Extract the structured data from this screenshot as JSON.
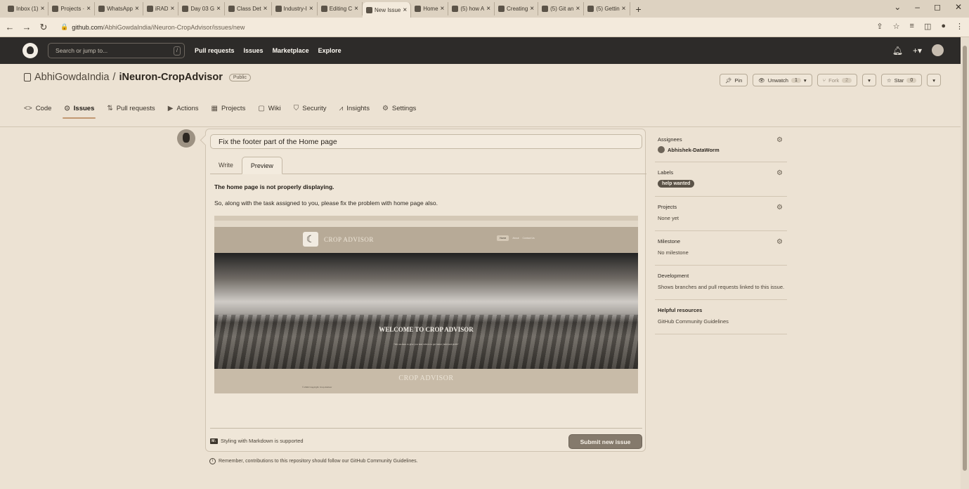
{
  "browser": {
    "tabs": [
      {
        "label": "Inbox (1)",
        "active": false
      },
      {
        "label": "Projects ·",
        "active": false
      },
      {
        "label": "WhatsApp",
        "active": false
      },
      {
        "label": "iRAD",
        "active": false
      },
      {
        "label": "Day 03 G",
        "active": false
      },
      {
        "label": "Class Det",
        "active": false
      },
      {
        "label": "Industry-I",
        "active": false
      },
      {
        "label": "Editing C",
        "active": false
      },
      {
        "label": "New Issue",
        "active": true
      },
      {
        "label": "Home",
        "active": false
      },
      {
        "label": "(5) how A",
        "active": false
      },
      {
        "label": "Creating",
        "active": false
      },
      {
        "label": "(5) Git an",
        "active": false
      },
      {
        "label": "(5) Gettin",
        "active": false
      }
    ],
    "new_tab": "+",
    "url_host": "github.com",
    "url_path": "/AbhiGowdaIndia/iNeuron-CropAdvisor/issues/new"
  },
  "gh": {
    "search_placeholder": "Search or jump to...",
    "search_shortcut": "/",
    "nav": [
      "Pull requests",
      "Issues",
      "Marketplace",
      "Explore"
    ]
  },
  "repo": {
    "owner": "AbhiGowdaIndia",
    "separator": "/",
    "name": "iNeuron-CropAdvisor",
    "visibility": "Public",
    "pin_label": "Pin",
    "unwatch_label": "Unwatch",
    "watch_count": "1",
    "fork_label": "Fork",
    "fork_count": "2",
    "star_label": "Star",
    "star_count": "0",
    "tabs": [
      {
        "icon": "<>",
        "label": "Code"
      },
      {
        "icon": "⊙",
        "label": "Issues"
      },
      {
        "icon": "⇅",
        "label": "Pull requests"
      },
      {
        "icon": "▶",
        "label": "Actions"
      },
      {
        "icon": "▦",
        "label": "Projects"
      },
      {
        "icon": "▢",
        "label": "Wiki"
      },
      {
        "icon": "⛉",
        "label": "Security"
      },
      {
        "icon": "⩘",
        "label": "Insights"
      },
      {
        "icon": "⚙",
        "label": "Settings"
      }
    ]
  },
  "issue": {
    "title": "Fix the footer part of the Home page",
    "write_tab": "Write",
    "preview_tab": "Preview",
    "body_heading": "The home page is not properly displaying.",
    "body_text": "So, along with the task assigned to you, please fix the problem with home page also.",
    "markdown_note": "Styling with Markdown is supported",
    "submit_label": "Submit new issue",
    "remember_note": "Remember, contributions to this repository should follow our GitHub Community Guidelines."
  },
  "embedded_screenshot": {
    "brand": "CROP ADVISOR",
    "menu": [
      "Home",
      "About",
      "Contact Us"
    ],
    "welcome": "WELCOME TO CROP ADVISOR",
    "tagline": "\"We are here to give you best advice to get better yield and profit\"",
    "footer_brand": "CROP ADVISOR",
    "copyright": "© 2022 Copyright: Crop Advisor"
  },
  "sidebar": {
    "assignees_title": "Assignees",
    "assignee": "Abhishek-DataWorm",
    "labels_title": "Labels",
    "label": "help wanted",
    "projects_title": "Projects",
    "projects_value": "None yet",
    "milestone_title": "Milestone",
    "milestone_value": "No milestone",
    "development_title": "Development",
    "development_value": "Shows branches and pull requests linked to this issue.",
    "helpful_title": "Helpful resources",
    "helpful_link": "GitHub Community Guidelines"
  }
}
